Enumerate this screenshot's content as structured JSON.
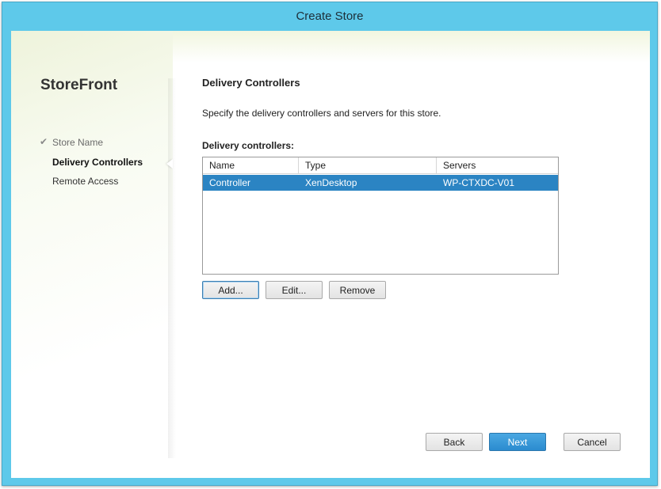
{
  "window": {
    "title": "Create Store"
  },
  "sidebar": {
    "brand": "StoreFront",
    "steps": [
      {
        "label": "Store Name",
        "state": "done"
      },
      {
        "label": "Delivery Controllers",
        "state": "current"
      },
      {
        "label": "Remote Access",
        "state": "pending"
      }
    ]
  },
  "main": {
    "heading": "Delivery Controllers",
    "description": "Specify the delivery controllers and servers for this store.",
    "list_label": "Delivery controllers:",
    "columns": [
      "Name",
      "Type",
      "Servers"
    ],
    "rows": [
      {
        "name": "Controller",
        "type": "XenDesktop",
        "servers": "WP-CTXDC-V01",
        "selected": true
      }
    ],
    "buttons": {
      "add": "Add...",
      "edit": "Edit...",
      "remove": "Remove"
    }
  },
  "footer": {
    "back": "Back",
    "next": "Next",
    "cancel": "Cancel"
  },
  "colors": {
    "titlebar": "#5ec9ea",
    "selection": "#2b84c3",
    "primary_button": "#2b8bcf"
  },
  "icons": {
    "done_step": "check-icon"
  }
}
